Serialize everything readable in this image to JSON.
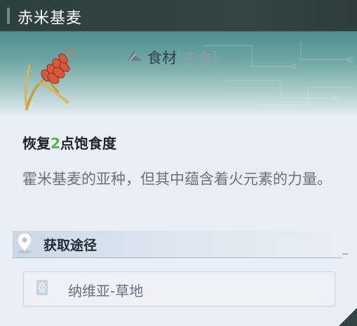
{
  "item": {
    "name": "赤米基麦",
    "type_label": "食材",
    "type_sub": "[主食]",
    "effect_prefix": "恢复",
    "effect_value": "2",
    "effect_suffix": "点饱食度",
    "description": "霍米基麦的亚种，但其中蕴含着火元素的力量。"
  },
  "source": {
    "label": "获取途径",
    "locations": [
      "纳维亚-草地"
    ]
  },
  "icons": {
    "item": "red-wheat-icon",
    "type": "food-ingredient-icon",
    "source": "location-pin-icon",
    "location": "region-emblem-icon"
  },
  "colors": {
    "title_bg": "#324443",
    "accent_green": "#59b24e",
    "hero_teal": "#4d8f8e"
  }
}
